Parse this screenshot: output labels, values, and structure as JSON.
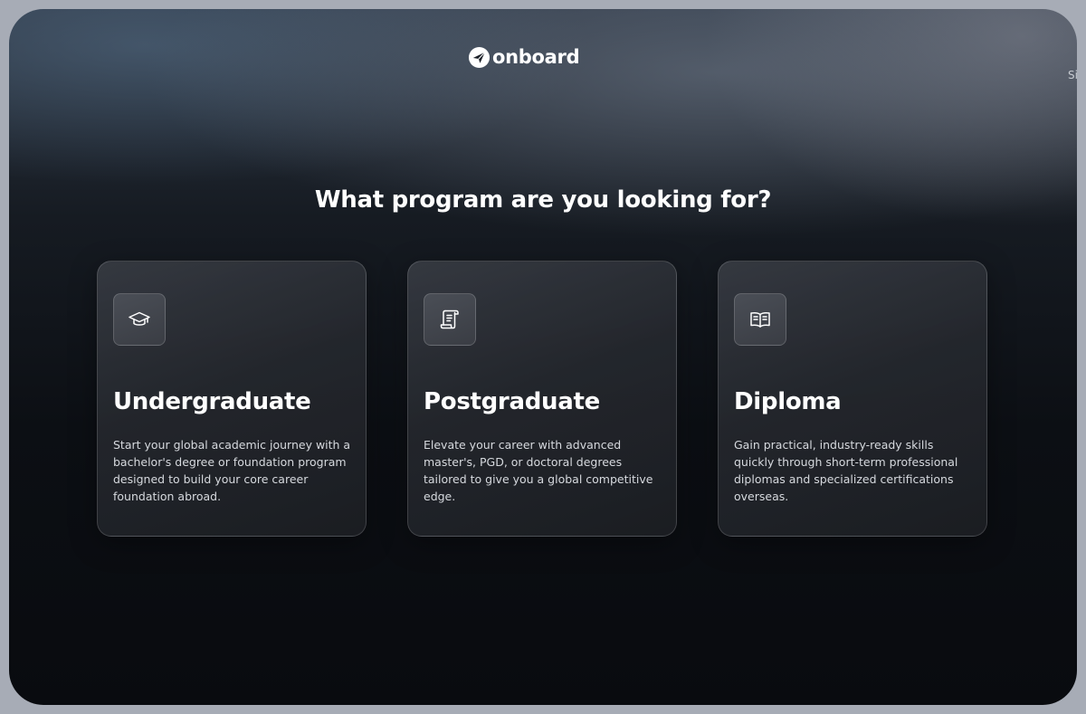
{
  "app": {
    "logo_text": "onboard",
    "edge_text": "Si"
  },
  "page": {
    "heading": "What program are you looking for?"
  },
  "cards": [
    {
      "icon": "graduation-cap-icon",
      "title": "Undergraduate",
      "description": "Start your global academic journey with a bachelor's degree or foundation program designed to build your core career foundation abroad."
    },
    {
      "icon": "scroll-document-icon",
      "title": "Postgraduate",
      "description": "Elevate your career with advanced master's, PGD, or doctoral degrees tailored to give you a global competitive edge."
    },
    {
      "icon": "open-book-icon",
      "title": "Diploma",
      "description": "Gain practical, industry-ready skills quickly through short-term professional diplomas and specialized certifications overseas."
    }
  ],
  "colors": {
    "background_dark": "#0c0f14",
    "card_border": "#3c4048",
    "text_primary": "#ffffff",
    "text_secondary": "#d6d9de"
  }
}
